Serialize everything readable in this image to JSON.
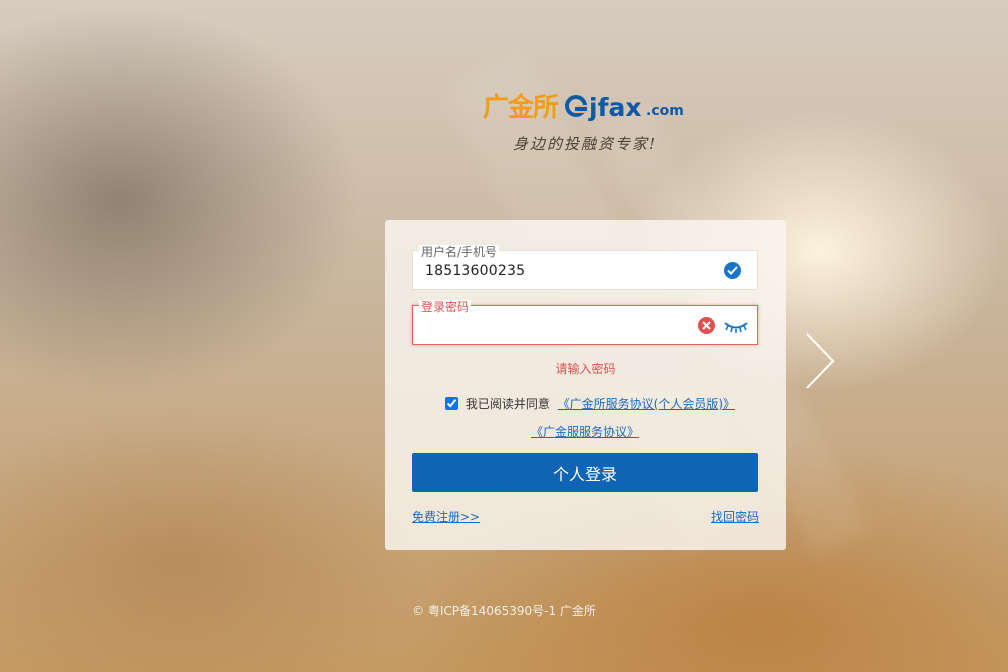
{
  "brand": {
    "name_cn": "广金所",
    "name_en": "jfax",
    "domain_suffix": ".com",
    "slogan": "身边的投融资专家!",
    "colors": {
      "orange": "#f29c1b",
      "blue": "#0e5aa6"
    }
  },
  "login": {
    "username": {
      "label": "用户名/手机号",
      "value": "18513600235",
      "status": "valid"
    },
    "password": {
      "label": "登录密码",
      "value": "",
      "status": "error"
    },
    "error_message": "请输入密码",
    "agreement": {
      "checked": true,
      "text": "我已阅读并同意",
      "link1": "《广金所服务协议(个人会员版)》",
      "link2": "《广金服服务协议》"
    },
    "submit_label": "个人登录",
    "register_link": "免费注册>>",
    "forgot_link": "找回密码",
    "accent_color": "#0f64b4",
    "error_color": "#e05050"
  },
  "footer": {
    "text": "© 粤ICP备14065390号-1 广金所"
  },
  "icons": {
    "valid": "check-circle-icon",
    "clear": "close-circle-icon",
    "toggle_visibility": "eye-closed-icon",
    "next": "chevron-right-icon"
  }
}
